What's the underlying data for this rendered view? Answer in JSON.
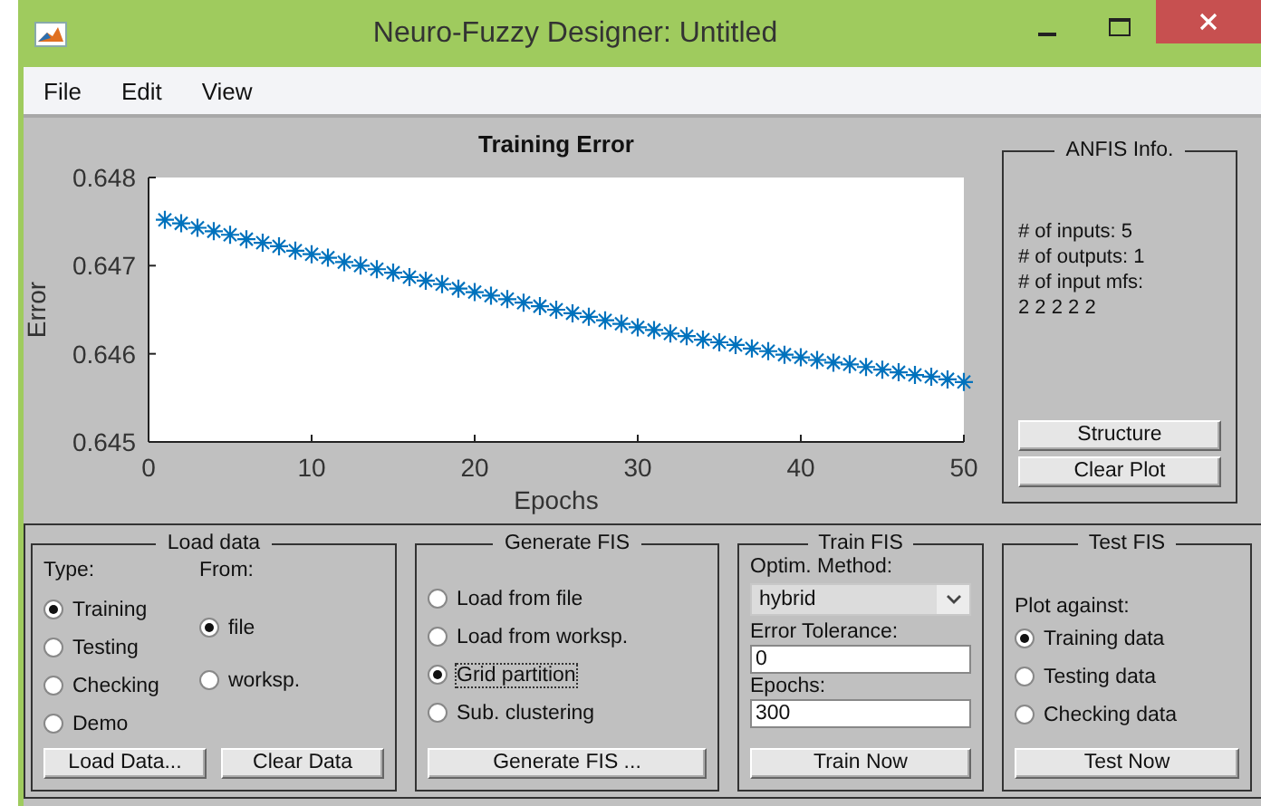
{
  "window": {
    "title": "Neuro-Fuzzy Designer: Untitled"
  },
  "menu": [
    {
      "label": "File"
    },
    {
      "label": "Edit"
    },
    {
      "label": "View"
    }
  ],
  "plot": {
    "chart_data": {
      "type": "scatter",
      "title": "Training Error",
      "xlabel": "Epochs",
      "ylabel": "Error",
      "x": [
        1,
        2,
        3,
        4,
        5,
        6,
        7,
        8,
        9,
        10,
        11,
        12,
        13,
        14,
        15,
        16,
        17,
        18,
        19,
        20,
        21,
        22,
        23,
        24,
        25,
        26,
        27,
        28,
        29,
        30,
        31,
        32,
        33,
        34,
        35,
        36,
        37,
        38,
        39,
        40,
        41,
        42,
        43,
        44,
        45,
        46,
        47,
        48,
        49,
        50
      ],
      "series": [
        {
          "color": "#0072bd",
          "values": [
            0.64752,
            0.64748,
            0.64743,
            0.64739,
            0.64735,
            0.6473,
            0.64726,
            0.64722,
            0.64717,
            0.64713,
            0.64709,
            0.64704,
            0.647,
            0.64696,
            0.64692,
            0.64687,
            0.64683,
            0.64679,
            0.64674,
            0.6467,
            0.64666,
            0.64662,
            0.64658,
            0.64654,
            0.6465,
            0.64646,
            0.64642,
            0.64638,
            0.64634,
            0.6463,
            0.64627,
            0.64623,
            0.6462,
            0.64616,
            0.64613,
            0.6461,
            0.64606,
            0.64603,
            0.64599,
            0.64596,
            0.64593,
            0.6459,
            0.64588,
            0.64585,
            0.64582,
            0.64579,
            0.64576,
            0.64574,
            0.64571,
            0.64568
          ]
        }
      ],
      "xlim": [
        0,
        50
      ],
      "ylim": [
        0.645,
        0.648
      ],
      "xticks": [
        0,
        10,
        20,
        30,
        40,
        50
      ],
      "yticks": [
        0.645,
        0.646,
        0.647,
        0.648
      ]
    }
  },
  "anfis_info": {
    "title": "ANFIS Info.",
    "lines": [
      "# of inputs: 5",
      "# of outputs: 1",
      "# of input mfs:",
      "2 2 2 2 2"
    ],
    "buttons": [
      "Structure",
      "Clear Plot"
    ]
  },
  "load_data": {
    "title": "Load data",
    "type_label": "Type:",
    "from_label": "From:",
    "type_options": [
      {
        "label": "Training",
        "selected": true
      },
      {
        "label": "Testing",
        "selected": false
      },
      {
        "label": "Checking",
        "selected": false
      },
      {
        "label": "Demo",
        "selected": false
      }
    ],
    "from_options": [
      {
        "label": "file",
        "selected": true
      },
      {
        "label": "worksp.",
        "selected": false
      }
    ],
    "buttons": [
      "Load Data...",
      "Clear Data"
    ]
  },
  "generate_fis": {
    "title": "Generate FIS",
    "options": [
      {
        "label": "Load from file",
        "selected": false,
        "focused": false
      },
      {
        "label": "Load from worksp.",
        "selected": false,
        "focused": false
      },
      {
        "label": "Grid partition",
        "selected": true,
        "focused": true
      },
      {
        "label": "Sub. clustering",
        "selected": false,
        "focused": false
      }
    ],
    "button": "Generate FIS ..."
  },
  "train_fis": {
    "title": "Train FIS",
    "method_label": "Optim. Method:",
    "method": "hybrid",
    "error_tolerance_label": "Error Tolerance:",
    "error_tolerance": "0",
    "epochs_label": "Epochs:",
    "epochs": "300",
    "button": "Train Now"
  },
  "test_fis": {
    "title": "Test FIS",
    "plot_against_label": "Plot against:",
    "options": [
      {
        "label": "Training data",
        "selected": true
      },
      {
        "label": "Testing data",
        "selected": false
      },
      {
        "label": "Checking data",
        "selected": false
      }
    ],
    "button": "Test Now"
  }
}
